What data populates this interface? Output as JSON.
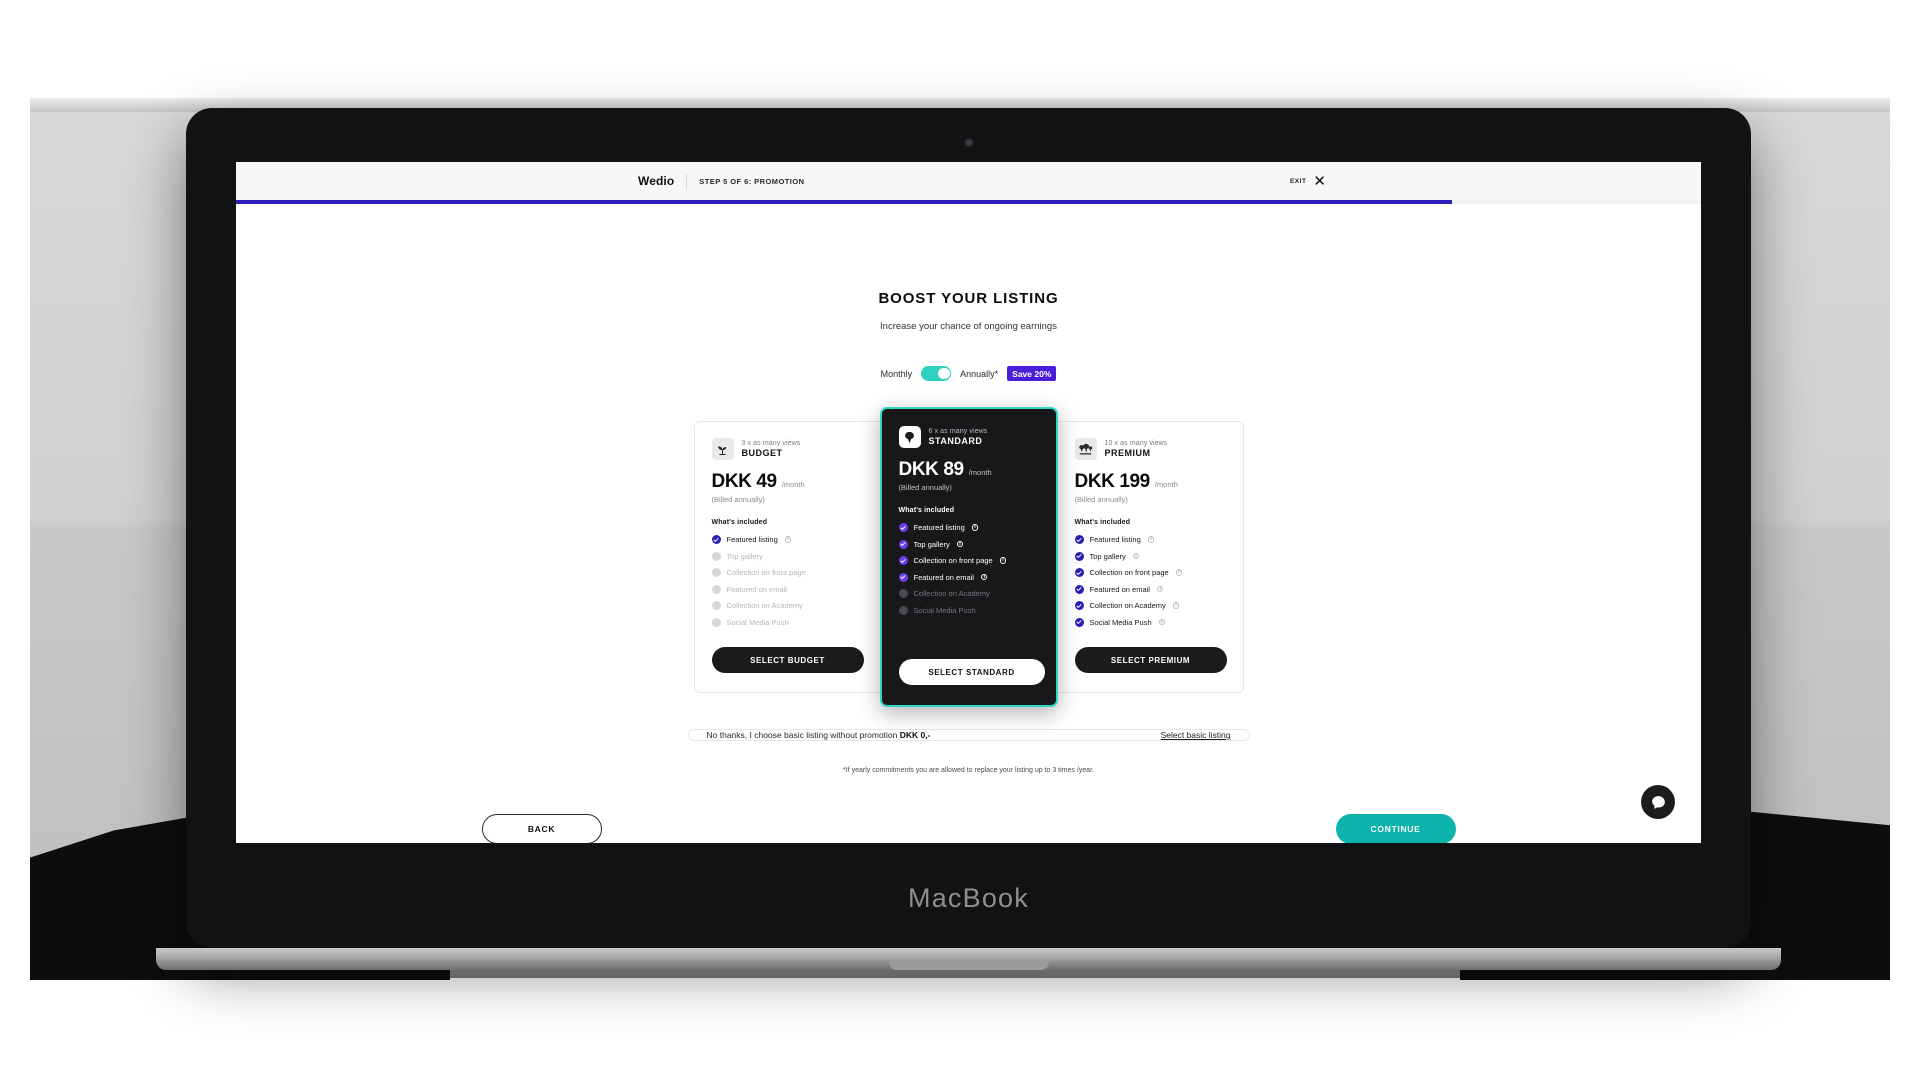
{
  "device": {
    "brand": "MacBook"
  },
  "topbar": {
    "brand": "Wedio",
    "step_label": "STEP 5 OF 6: PROMOTION",
    "exit_label": "EXIT",
    "exit_icon": "close-icon",
    "progress_percent": 83,
    "progress_color": "#2a1fb8"
  },
  "page": {
    "headline": "BOOST YOUR LISTING",
    "subhead": "Increase your chance of ongoing earnings"
  },
  "billing_toggle": {
    "left_label": "Monthly",
    "right_label": "Annually*",
    "selected": "Annually",
    "badge": "Save 20%",
    "badge_color": "#4a1ddb",
    "track_color": "#2ed0c0"
  },
  "plans": [
    {
      "id": "budget",
      "views": "3 x as many views",
      "name": "BUDGET",
      "icon": "seedling-icon",
      "price": "DKK 49",
      "per": "/month",
      "billed": "(Billed annually)",
      "included_title": "What's included",
      "features": [
        {
          "label": "Featured listing",
          "active": true,
          "info": true
        },
        {
          "label": "Top gallery",
          "active": false,
          "info": false
        },
        {
          "label": "Collection on front page",
          "active": false,
          "info": false
        },
        {
          "label": "Featured on email",
          "active": false,
          "info": false
        },
        {
          "label": "Collection on Academy",
          "active": false,
          "info": false
        },
        {
          "label": "Social Media Push",
          "active": false,
          "info": false
        }
      ],
      "cta": "SELECT BUDGET",
      "featured": false
    },
    {
      "id": "standard",
      "views": "6 x as many views",
      "name": "STANDARD",
      "icon": "tree-icon",
      "price": "DKK 89",
      "per": "/month",
      "billed": "(Billed annually)",
      "included_title": "What's included",
      "features": [
        {
          "label": "Featured listing",
          "active": true,
          "info": true
        },
        {
          "label": "Top gallery",
          "active": true,
          "info": true
        },
        {
          "label": "Collection on front page",
          "active": true,
          "info": true
        },
        {
          "label": "Featured on email",
          "active": true,
          "info": true
        },
        {
          "label": "Collection on Academy",
          "active": false,
          "info": false
        },
        {
          "label": "Social Media Push",
          "active": false,
          "info": false
        }
      ],
      "cta": "SELECT STANDARD",
      "featured": true
    },
    {
      "id": "premium",
      "views": "10 x as many views",
      "name": "PREMIUM",
      "icon": "forest-icon",
      "price": "DKK 199",
      "per": "/month",
      "billed": "(Billed annually)",
      "included_title": "What's included",
      "features": [
        {
          "label": "Featured listing",
          "active": true,
          "info": true
        },
        {
          "label": "Top gallery",
          "active": true,
          "info": true
        },
        {
          "label": "Collection on front page",
          "active": true,
          "info": true
        },
        {
          "label": "Featured on email",
          "active": true,
          "info": true
        },
        {
          "label": "Collection on Academy",
          "active": true,
          "info": true
        },
        {
          "label": "Social Media Push",
          "active": true,
          "info": true
        }
      ],
      "cta": "SELECT PREMIUM",
      "featured": false
    }
  ],
  "basic_listing": {
    "text_before": "No thanks, I choose basic listing without promotion ",
    "price": "DKK 0,-",
    "link": "Select basic listing"
  },
  "footnote": "*If yearly commitments you are allowed to replace your listing up to 3 times /year.",
  "footer": {
    "back": "BACK",
    "continue": "CONTINUE",
    "continue_color": "#0bb3aa"
  },
  "chat": {
    "icon": "chat-bubble-icon"
  }
}
